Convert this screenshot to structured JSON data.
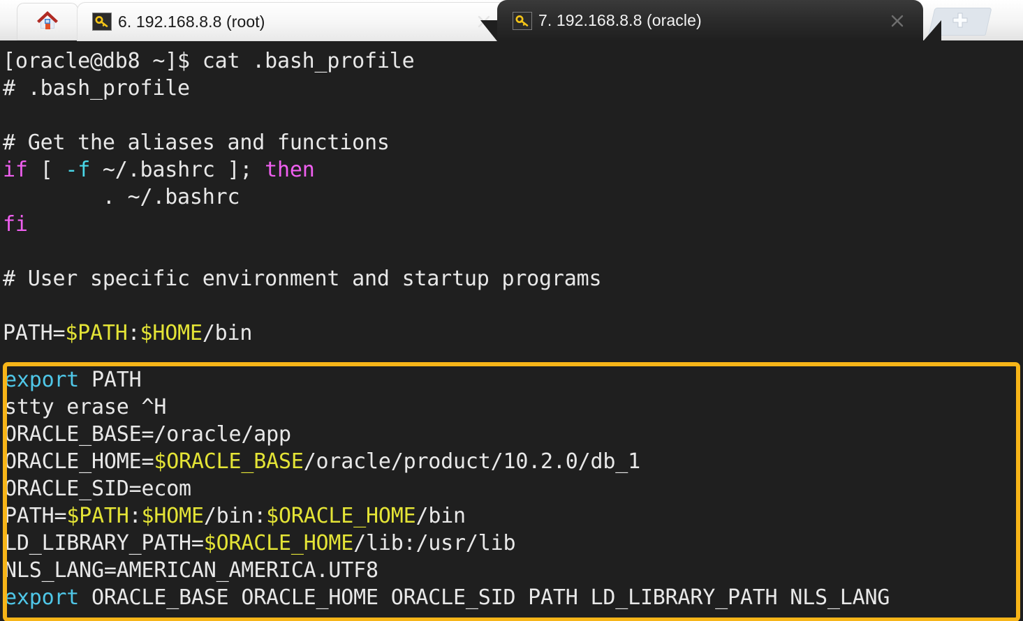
{
  "window": {
    "title": "7. 192.168.8.8 (oracle)",
    "background_color": "#1f1f1f"
  },
  "tabbar": {
    "home_tab": {
      "name": "home-tab",
      "icon": "house-icon",
      "label": ""
    },
    "tabs": [
      {
        "label": "6. 192.168.8.8 (root)",
        "icon": "key-icon",
        "active": false,
        "close_label": "×"
      },
      {
        "label": "7. 192.168.8.8 (oracle)",
        "icon": "key-icon",
        "active": true,
        "close_label": "×"
      }
    ],
    "new_tab": {
      "label": "+",
      "icon": "plus-icon"
    }
  },
  "terminal": {
    "prompt": "[oracle@db8 ~]$ ",
    "command": "cat .bash_profile",
    "colors": {
      "background": "#1f1f1f",
      "foreground": "#e8e8e8",
      "keyword": "#ef5fef",
      "cyan": "#4fc7e8",
      "variable": "#e4e436",
      "highlight_border": "#f7b518"
    },
    "lines": [
      "# .bash_profile",
      "",
      "# Get the aliases and functions",
      "if [ -f ~/.bashrc ]; then",
      "        . ~/.bashrc",
      "fi",
      "",
      "# User specific environment and startup programs",
      "",
      "PATH=$PATH:$HOME/bin",
      "",
      "export PATH",
      "stty erase ^H",
      "ORACLE_BASE=/oracle/app",
      "ORACLE_HOME=$ORACLE_BASE/oracle/product/10.2.0/db_1",
      "ORACLE_SID=ecom",
      "PATH=$PATH:$HOME/bin:$ORACLE_HOME/bin",
      "LD_LIBRARY_PATH=$ORACLE_HOME/lib:/usr/lib",
      "NLS_LANG=AMERICAN_AMERICA.UTF8",
      "export ORACLE_BASE ORACLE_HOME ORACLE_SID PATH LD_LIBRARY_PATH NLS_LANG"
    ],
    "segments": {
      "l0_prompt": "[oracle@db8 ~]$ cat .bash_profile",
      "l1": "# .bash_profile",
      "l3": "# Get the aliases and functions",
      "l4_if": "if",
      "l4_brk": " [ ",
      "l4_opt": "-f",
      "l4_rest": " ~/.bashrc ]; ",
      "l4_then": "then",
      "l5": "        . ~/.bashrc",
      "l6_fi": "fi",
      "l8": "# User specific environment and startup programs",
      "l10_a": "PATH=",
      "l10_b": "$PATH",
      "l10_c": ":",
      "l10_d": "$HOME",
      "l10_e": "/bin",
      "h0_export": "export",
      "h0_rest": " PATH",
      "h1": "stty erase ^H",
      "h2": "ORACLE_BASE=/oracle/app",
      "h3_a": "ORACLE_HOME=",
      "h3_b": "$ORACLE_BASE",
      "h3_c": "/oracle/product/10.2.0/db_1",
      "h4": "ORACLE_SID=ecom",
      "h5_a": "PATH=",
      "h5_b": "$PATH",
      "h5_c": ":",
      "h5_d": "$HOME",
      "h5_e": "/bin:",
      "h5_f": "$ORACLE_HOME",
      "h5_g": "/bin",
      "h6_a": "LD_LIBRARY_PATH=",
      "h6_b": "$ORACLE_HOME",
      "h6_c": "/lib:/usr/lib",
      "h7": "NLS_LANG=AMERICAN_AMERICA.UTF8",
      "h8_export": "export",
      "h8_rest": " ORACLE_BASE ORACLE_HOME ORACLE_SID PATH LD_LIBRARY_PATH NLS_LANG"
    }
  }
}
